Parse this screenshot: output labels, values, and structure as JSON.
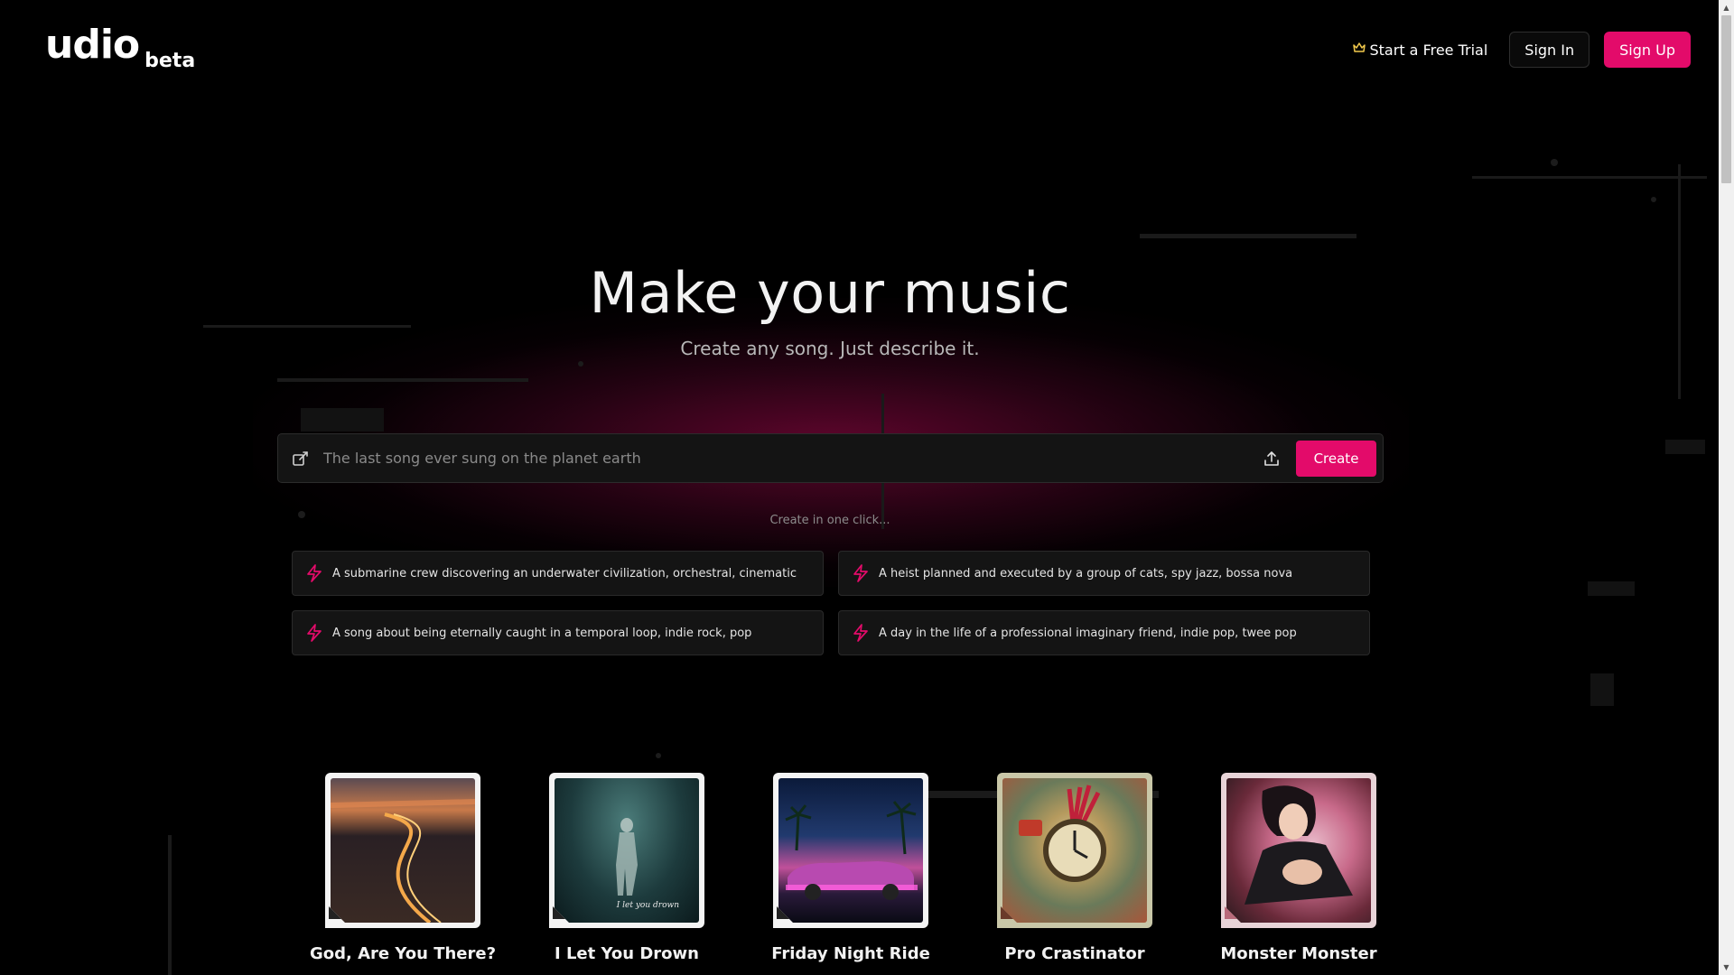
{
  "header": {
    "logo_text": "udio",
    "logo_badge": "beta",
    "trial_label": "Start a Free Trial",
    "signin_label": "Sign In",
    "signup_label": "Sign Up"
  },
  "hero": {
    "title": "Make your music",
    "subtitle": "Create any song. Just describe it."
  },
  "prompt": {
    "placeholder": "The last song ever sung on the planet earth",
    "value": "",
    "create_label": "Create"
  },
  "suggestions": {
    "heading": "Create in one click...",
    "items": [
      {
        "label": "A submarine crew discovering an underwater civilization, orchestral, cinematic"
      },
      {
        "label": "A heist planned and executed by a group of cats, spy jazz, bossa nova"
      },
      {
        "label": "A song about being eternally caught in a temporal loop, indie rock, pop"
      },
      {
        "label": "A day in the life of a professional imaginary friend, indie pop, twee pop"
      }
    ]
  },
  "songs": [
    {
      "title": "God, Are You There?"
    },
    {
      "title": "I Let You Drown",
      "cover_caption": "I let you drown"
    },
    {
      "title": "Friday Night Ride"
    },
    {
      "title": "Pro Crastinator"
    },
    {
      "title": "Monster Monster"
    }
  ],
  "colors": {
    "accent": "#e30b6a",
    "background": "#000000",
    "crown": "#f2c94c"
  },
  "icons": {
    "trial": "crown-icon",
    "prompt_left": "edit-icon",
    "prompt_right": "upload-icon",
    "suggestion": "bolt-icon"
  }
}
